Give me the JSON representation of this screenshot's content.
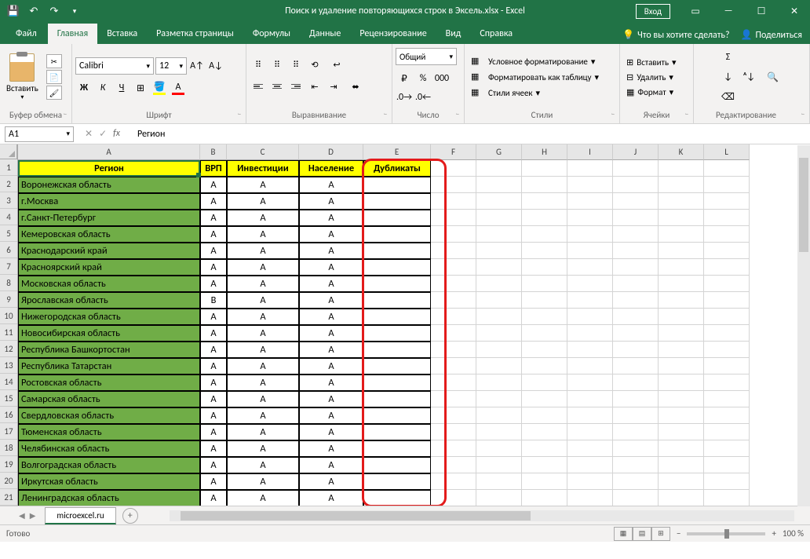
{
  "titlebar": {
    "title": "Поиск и удаление повторяющихся строк в Эксель.xlsx  -  Excel",
    "signin": "Вход"
  },
  "tabs": {
    "file": "Файл",
    "home": "Главная",
    "insert": "Вставка",
    "layout": "Разметка страницы",
    "formulas": "Формулы",
    "data": "Данные",
    "review": "Рецензирование",
    "view": "Вид",
    "help": "Справка",
    "tellme": "Что вы хотите сделать?",
    "share": "Поделиться"
  },
  "ribbon": {
    "paste": "Вставить",
    "clipboard": "Буфер обмена",
    "font_name": "Calibri",
    "font_size": "12",
    "font": "Шрифт",
    "alignment": "Выравнивание",
    "num_format": "Общий",
    "number": "Число",
    "cond_fmt": "Условное форматирование",
    "fmt_table": "Форматировать как таблицу",
    "cell_styles": "Стили ячеек",
    "styles": "Стили",
    "insert_cell": "Вставить",
    "delete_cell": "Удалить",
    "format_cell": "Формат",
    "cells": "Ячейки",
    "editing": "Редактирование"
  },
  "formula_bar": {
    "name_box": "A1",
    "formula": "Регион"
  },
  "columns": [
    "A",
    "B",
    "C",
    "D",
    "E",
    "F",
    "G",
    "H",
    "I",
    "J",
    "K",
    "L"
  ],
  "headers": {
    "A": "Регион",
    "B": "ВРП",
    "C": "Инвестиции",
    "D": "Население",
    "E": "Дубликаты"
  },
  "rows": [
    {
      "n": 2,
      "region": "Воронежская область",
      "b": "A",
      "c": "A",
      "d": "A"
    },
    {
      "n": 3,
      "region": "г.Москва",
      "b": "A",
      "c": "A",
      "d": "A"
    },
    {
      "n": 4,
      "region": "г.Санкт-Петербург",
      "b": "A",
      "c": "A",
      "d": "A"
    },
    {
      "n": 5,
      "region": "Кемеровская область",
      "b": "A",
      "c": "A",
      "d": "A"
    },
    {
      "n": 6,
      "region": "Краснодарский край",
      "b": "A",
      "c": "A",
      "d": "A"
    },
    {
      "n": 7,
      "region": "Красноярский край",
      "b": "A",
      "c": "A",
      "d": "A"
    },
    {
      "n": 8,
      "region": "Московская область",
      "b": "A",
      "c": "A",
      "d": "A"
    },
    {
      "n": 9,
      "region": "Ярославская область",
      "b": "B",
      "c": "A",
      "d": "A"
    },
    {
      "n": 10,
      "region": "Нижегородская область",
      "b": "A",
      "c": "A",
      "d": "A"
    },
    {
      "n": 11,
      "region": "Новосибирская область",
      "b": "A",
      "c": "A",
      "d": "A"
    },
    {
      "n": 12,
      "region": "Республика Башкортостан",
      "b": "A",
      "c": "A",
      "d": "A"
    },
    {
      "n": 13,
      "region": "Республика Татарстан",
      "b": "A",
      "c": "A",
      "d": "A"
    },
    {
      "n": 14,
      "region": "Ростовская область",
      "b": "A",
      "c": "A",
      "d": "A"
    },
    {
      "n": 15,
      "region": "Самарская область",
      "b": "A",
      "c": "A",
      "d": "A"
    },
    {
      "n": 16,
      "region": "Свердловская область",
      "b": "A",
      "c": "A",
      "d": "A"
    },
    {
      "n": 17,
      "region": "Тюменская область",
      "b": "A",
      "c": "A",
      "d": "A"
    },
    {
      "n": 18,
      "region": "Челябинская область",
      "b": "A",
      "c": "A",
      "d": "A"
    },
    {
      "n": 19,
      "region": "Волгоградская область",
      "b": "A",
      "c": "A",
      "d": "A"
    },
    {
      "n": 20,
      "region": "Иркутская область",
      "b": "A",
      "c": "A",
      "d": "A"
    },
    {
      "n": 21,
      "region": "Ленинградская область",
      "b": "A",
      "c": "A",
      "d": "A"
    }
  ],
  "sheet_tab": "microexcel.ru",
  "status": "Готово",
  "zoom": "100 %"
}
